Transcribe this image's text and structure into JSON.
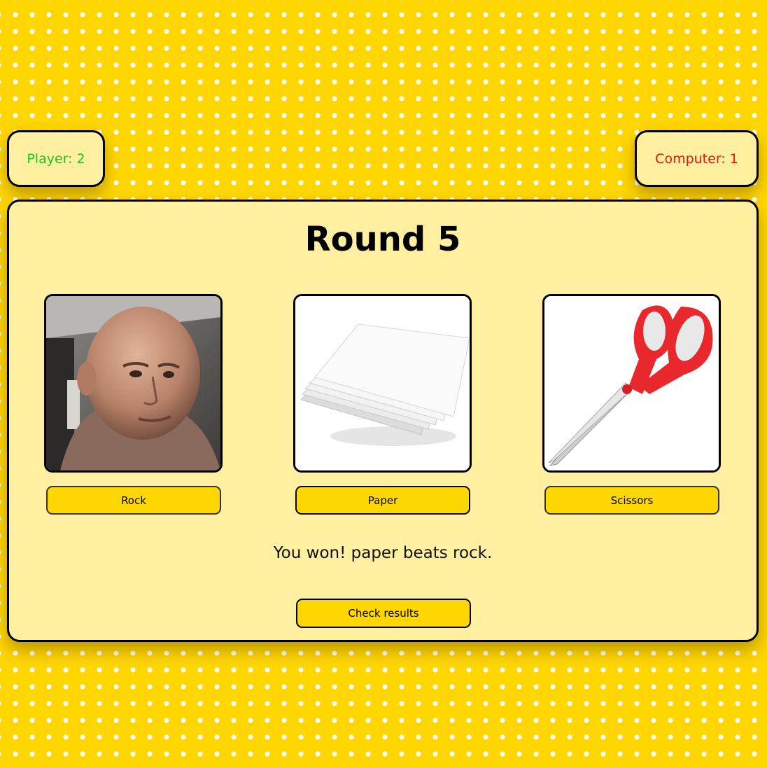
{
  "scores": {
    "player_label": "Player: 2",
    "computer_label": "Computer: 1"
  },
  "round": {
    "title": "Round 5"
  },
  "choices": [
    {
      "label": "Rock",
      "image": "rock-photo"
    },
    {
      "label": "Paper",
      "image": "paper-stack-photo"
    },
    {
      "label": "Scissors",
      "image": "scissors-photo"
    }
  ],
  "result": {
    "message": "You won! paper beats rock."
  },
  "actions": {
    "check_results_label": "Check results"
  },
  "colors": {
    "background": "#FFD700",
    "panel": "#FFEFA0",
    "button": "#FFD700",
    "player_score": "#1ec51e",
    "computer_score": "#f01010"
  }
}
